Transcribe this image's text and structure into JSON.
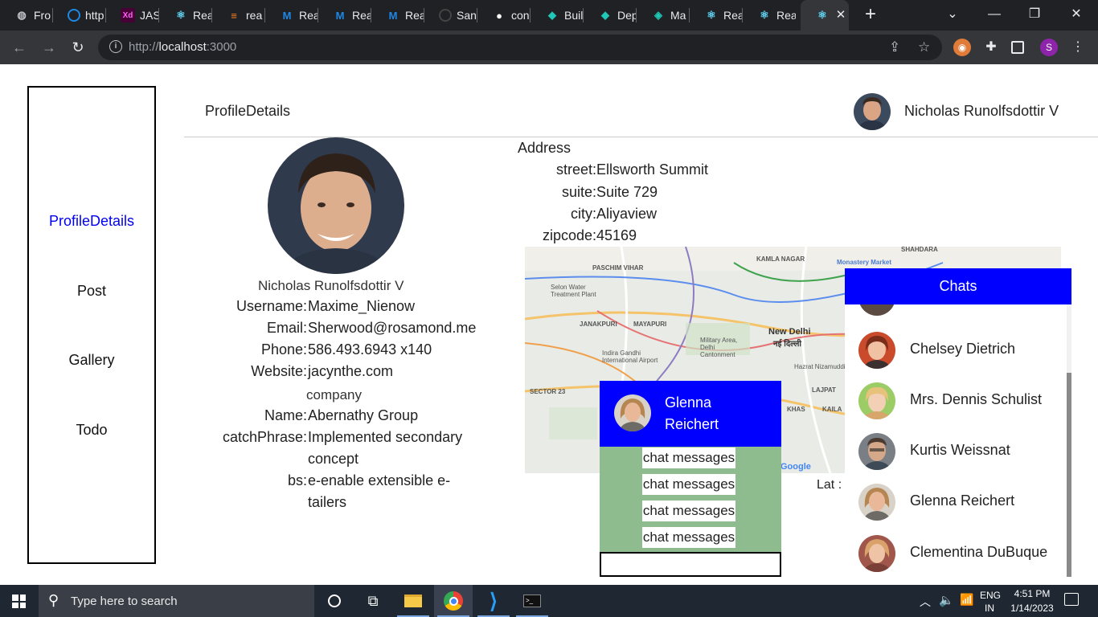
{
  "browser": {
    "tabs": [
      {
        "label": "Fro",
        "icon": "globe-icon"
      },
      {
        "label": "http",
        "icon": "circle-icon"
      },
      {
        "label": "JAS",
        "icon": "xd-icon"
      },
      {
        "label": "Rea",
        "icon": "react-icon"
      },
      {
        "label": "rea",
        "icon": "stackoverflow-icon"
      },
      {
        "label": "Rea",
        "icon": "mui-icon"
      },
      {
        "label": "Rea",
        "icon": "mui-icon"
      },
      {
        "label": "Rea",
        "icon": "mui-icon"
      },
      {
        "label": "San",
        "icon": "sandbox-icon"
      },
      {
        "label": "con",
        "icon": "github-icon"
      },
      {
        "label": "Buil",
        "icon": "diamond-icon"
      },
      {
        "label": "Dep",
        "icon": "deploy-error-icon"
      },
      {
        "label": "Ma",
        "icon": "diamond-icon"
      },
      {
        "label": "Rea",
        "icon": "react-icon"
      },
      {
        "label": "Rea",
        "icon": "react-icon"
      }
    ],
    "url_prefix": "http://",
    "url_host": "localhost",
    "url_suffix": ":3000",
    "profile_initial": "S"
  },
  "sidebar": {
    "items": [
      {
        "label": "ProfileDetails",
        "active": true
      },
      {
        "label": "Post",
        "active": false
      },
      {
        "label": "Gallery",
        "active": false
      },
      {
        "label": "Todo",
        "active": false
      }
    ]
  },
  "header": {
    "title": "ProfileDetails",
    "user_name": "Nicholas Runolfsdottir V"
  },
  "profile": {
    "name": "Nicholas Runolfsdottir V",
    "fields": [
      {
        "key": "Username:",
        "value": "Maxime_Nienow"
      },
      {
        "key": "Email:",
        "value": "Sherwood@rosamond.me"
      },
      {
        "key": "Phone:",
        "value": "586.493.6943 x140"
      },
      {
        "key": "Website:",
        "value": "jacynthe.com"
      }
    ],
    "company_label": "company",
    "company": [
      {
        "key": "Name:",
        "value": "Abernathy Group"
      },
      {
        "key": "catchPhrase:",
        "value": "Implemented secondary",
        "value2": "concept"
      },
      {
        "key": "bs:",
        "value": "e-enable extensible e-",
        "value2": "tailers"
      }
    ]
  },
  "address": {
    "title": "Address",
    "fields": [
      {
        "key": "street:",
        "value": "Ellsworth Summit"
      },
      {
        "key": "suite:",
        "value": "Suite 729"
      },
      {
        "key": "city:",
        "value": "Aliyaview"
      },
      {
        "key": "zipcode:",
        "value": "45169"
      }
    ],
    "lat_label": "Lat :"
  },
  "map": {
    "labels": [
      "PASCHIM VIHAR",
      "KAMLA NAGAR",
      "SHAHDARA",
      "Monastery Market",
      "JANAKPURI",
      "MAYAPURI",
      "New Delhi",
      "नई दिल्ली",
      "Indira Gandhi International Airport",
      "SECTOR 23",
      "Hazrat Nizamuddin",
      "LAJPAT",
      "KHAS",
      "KAILA",
      "Military Area, Delhi Cantonment",
      "Selon Water Treatment Plant",
      "Google"
    ]
  },
  "chat_window": {
    "name": "Glenna Reichert",
    "messages": [
      "chat messages",
      "chat messages",
      "chat messages",
      "chat messages"
    ],
    "input_value": ""
  },
  "chats": {
    "title": "Chats",
    "items": [
      {
        "name": "Chelsey Dietrich"
      },
      {
        "name": "Mrs. Dennis Schulist"
      },
      {
        "name": "Kurtis Weissnat"
      },
      {
        "name": "Glenna Reichert"
      },
      {
        "name": "Clementina DuBuque"
      }
    ]
  },
  "taskbar": {
    "search_placeholder": "Type here to search",
    "lang": "ENG",
    "region": "IN",
    "time": "4:51 PM",
    "date": "1/14/2023"
  }
}
